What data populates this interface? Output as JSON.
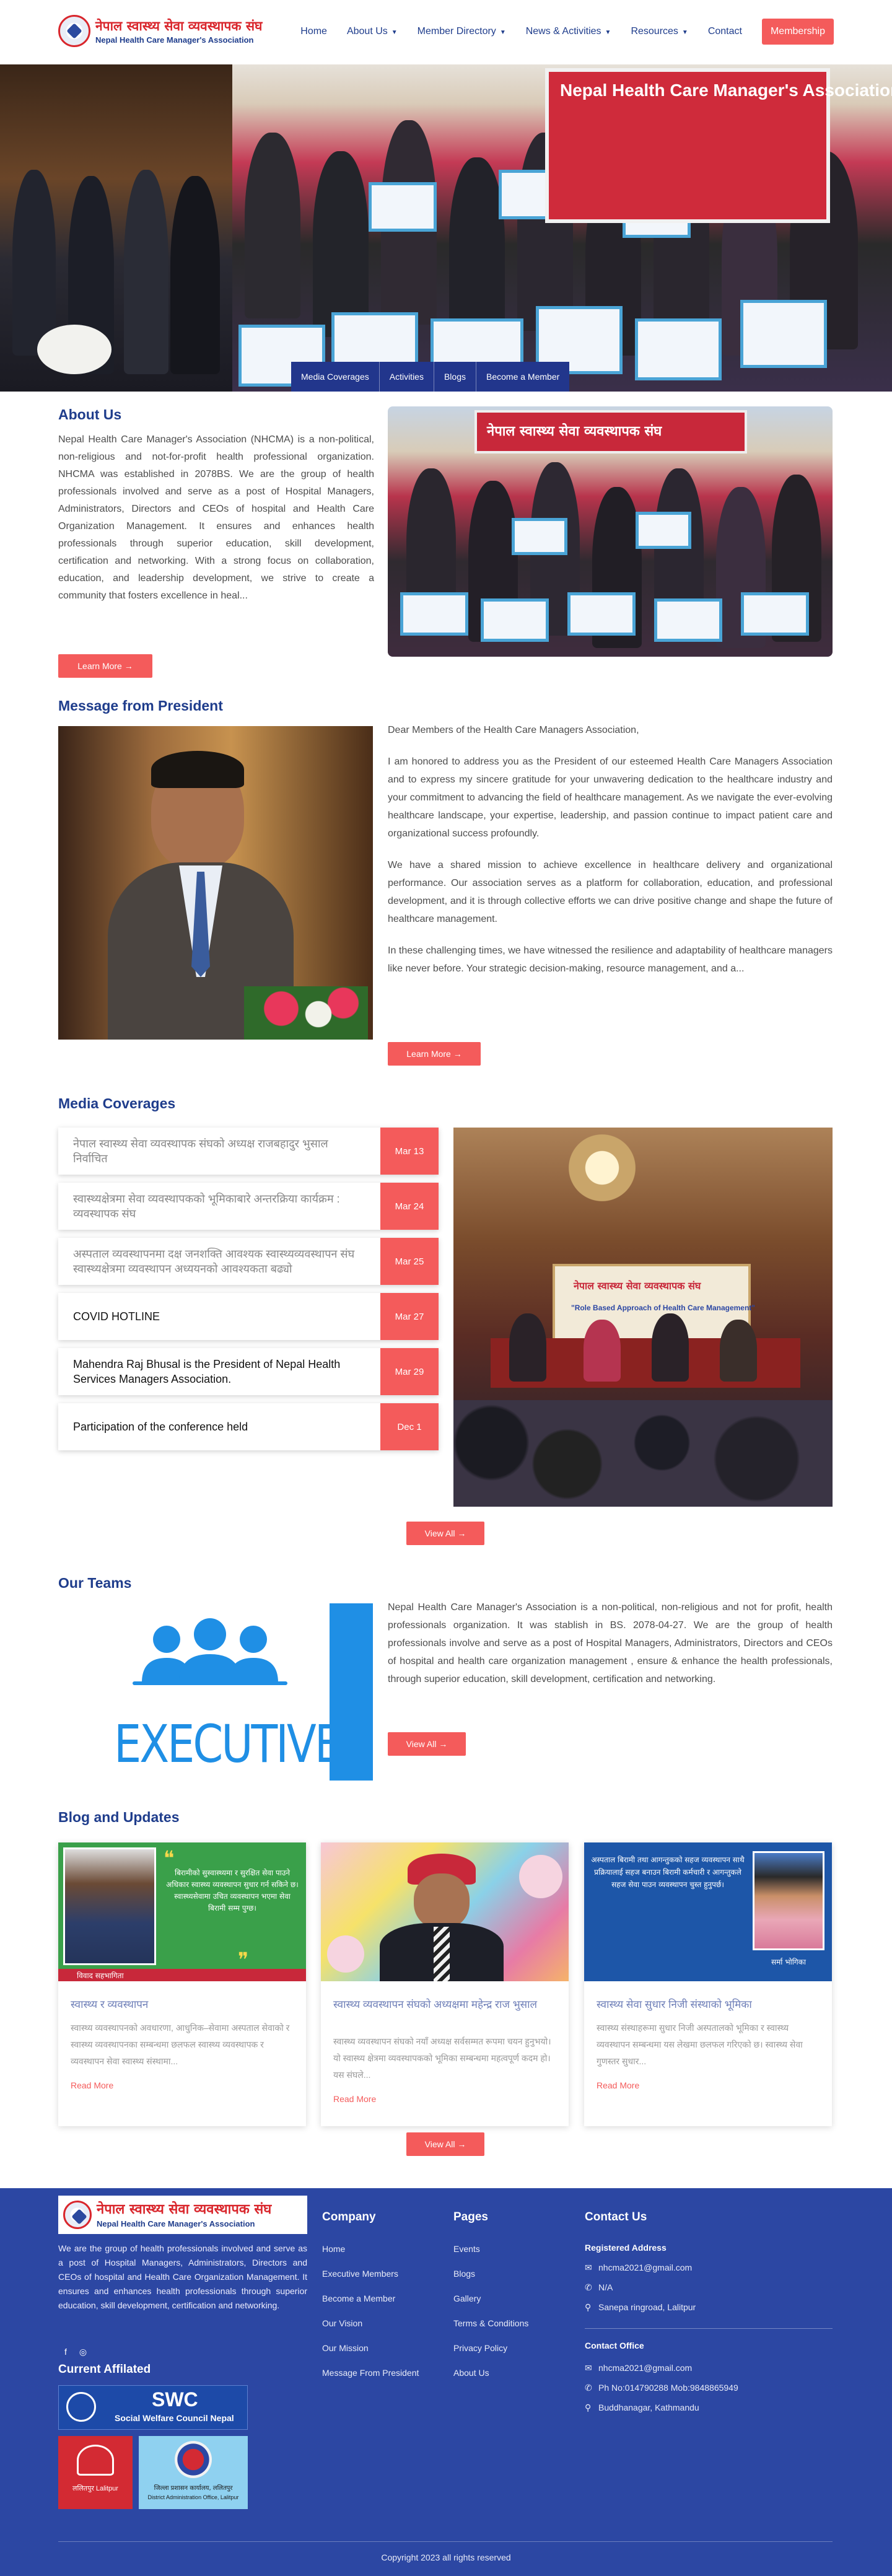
{
  "colors": {
    "primary_blue": "#1f3d8c",
    "accent_red": "#f45b5b",
    "footer_blue": "#2c47a3",
    "team_blue": "#1f8fe5"
  },
  "header": {
    "logo_np": "नेपाल स्वास्थ्य सेवा व्यवस्थापक संघ",
    "logo_en": "Nepal Health Care Manager's Association",
    "nav": [
      {
        "label": "Home",
        "dropdown": false
      },
      {
        "label": "About Us",
        "dropdown": true
      },
      {
        "label": "Member Directory",
        "dropdown": true
      },
      {
        "label": "News & Activities",
        "dropdown": true
      },
      {
        "label": "Resources",
        "dropdown": true
      },
      {
        "label": "Contact",
        "dropdown": false
      }
    ],
    "membership_label": "Membership"
  },
  "hero": {
    "banner_text": "Nepal Health Care Manager's Association",
    "tabs": [
      "Media Coverages",
      "Activities",
      "Blogs",
      "Become a Member"
    ]
  },
  "about": {
    "title": "About Us",
    "text": "Nepal Health Care Manager's Association (NHCMA) is a non-political, non-religious and not-for-profit health professional organization. NHCMA was established in 2078BS. We are the group of health professionals involved and serve as a post of Hospital Managers, Administrators, Directors and CEOs of hospital and Health Care Organization Management. It ensures and enhances health professionals through superior education, skill development, certification and networking. With a strong focus on collaboration, education, and leadership development, we strive to create a community that fosters excellence in heal...",
    "button": "Learn More →",
    "photo_banner": "नेपाल स्वास्थ्य सेवा व्यवस्थापक संघ"
  },
  "president": {
    "title": "Message from President",
    "paragraphs": [
      "Dear Members of the Health Care Managers Association,",
      "I am honored to address you as the President of our esteemed Health Care Managers Association and to express my sincere gratitude for your unwavering dedication to the healthcare industry and your commitment to advancing the field of healthcare management. As we navigate the ever-evolving healthcare landscape, your expertise, leadership, and passion continue to impact patient care and organizational success profoundly.",
      "We have a shared mission to achieve excellence in healthcare delivery and organizational performance. Our association serves as a platform for collaboration, education, and professional development, and it is through collective efforts we can drive positive change and shape the future of healthcare management.",
      "In these challenging times, we have witnessed the resilience and adaptability of healthcare managers like never before. Your strategic decision-making, resource management, and a..."
    ],
    "button": "Learn More →"
  },
  "media": {
    "title": "Media Coverages",
    "items": [
      {
        "title": "नेपाल स्वास्थ्य सेवा व्यवस्थापक संघको अध्यक्ष राजबहादुर भुसाल निर्वाचित",
        "date": "Mar 13",
        "faded": true
      },
      {
        "title": "स्वास्थ्यक्षेत्रमा सेवा व्यवस्थापकको भूमिकाबारे अन्तरक्रिया कार्यक्रम : व्यवस्थापक संघ",
        "date": "Mar 24",
        "faded": true
      },
      {
        "title": "अस्पताल व्यवस्थापनमा दक्ष जनशक्ति आवश्यक स्वास्थ्यव्यवस्थापन संघ स्वास्थ्यक्षेत्रमा व्यवस्थापन अध्ययनको आवश्यकता बढ्यो",
        "date": "Mar 25",
        "faded": true
      },
      {
        "title": "COVID HOTLINE",
        "date": "Mar 27",
        "faded": false
      },
      {
        "title": "Mahendra Raj Bhusal is the President of Nepal Health Services Managers Association.",
        "date": "Mar 29",
        "faded": false
      },
      {
        "title": "Participation of the conference held",
        "date": "Dec 1",
        "faded": false
      }
    ],
    "photo_banner": "नेपाल स्वास्थ्य सेवा व्यवस्थापक संघ",
    "photo_subtitle": "\"Role Based Approach of Health Care Management\"",
    "button": "View All →"
  },
  "teams": {
    "title": "Our Teams",
    "image_label": "EXECUTIVE COMMITTEE",
    "text": "Nepal Health Care Manager's Association is a non-political, non-religious and not for profit, health professionals organization. It was stablish in BS. 2078-04-27. We are the group of health professionals involve and serve as a post of Hospital Managers, Administrators, Directors and CEOs of hospital and health care organization management , ensure & enhance the health professionals, through superior education, skill development, certification and networking.",
    "button": "View All →"
  },
  "blog": {
    "title": "Blog and Updates",
    "posts": [
      {
        "title": "स्वास्थ्य र व्यवस्थापन",
        "excerpt": "स्वास्थ्य व्यवस्थापनको अवधारणा, आधुनिक–सेवामा अस्पताल सेवाको र स्वास्थ्य व्यवस्थापनका सम्बन्धमा छलफल स्वास्थ्य व्यवस्थापक र व्यवस्थापन सेवा स्वास्थ्य संस्थामा...",
        "image_quote": "बिरामीको सुस्वास्थ्यमा र सुरक्षित सेवा पाउने अधिकार स्वास्थ्य व्यवस्थापन सुधार गर्न सकिने छ। स्वास्थ्यसेवामा उचित व्यवस्थापन भएमा सेवा बिरामी सम्म पुग्छ।",
        "image_caption": "विवाद सहभागिता",
        "readmore": "Read More"
      },
      {
        "title": "स्वास्थ्य व्यवस्थापन संघको अध्यक्षमा महेन्द्र राज भुसाल",
        "excerpt": "स्वास्थ्य व्यवस्थापन संघको नयाँ अध्यक्ष सर्वसम्मत रूपमा चयन हुनुभयो। यो स्वास्थ्य क्षेत्रमा व्यवस्थापकको भूमिका सम्बन्धमा महत्वपूर्ण कदम हो। यस संघले...",
        "readmore": "Read More"
      },
      {
        "title": "स्वास्थ्य सेवा सुधार निजी संस्थाको भूमिका",
        "excerpt": "स्वास्थ्य संस्थाहरूमा सुधार निजी अस्पतालको भूमिका र स्वास्थ्य व्यवस्थापन सम्बन्धमा यस लेखमा छलफल गरिएको छ। स्वास्थ्य सेवा गुणस्तर सुधार...",
        "image_quote": "अस्पताल बिरामी तथा आगन्तुकको सहज व्यवस्थापन साथै प्रक्रियालाई सहज बनाउन बिरामी कर्मचारी र आगन्तुकले सहज सेवा पाउन व्यवस्थापन चुस्त हुनुपर्छ।",
        "image_caption": "सर्मा भोगिका",
        "readmore": "Read More"
      }
    ],
    "button": "View All →"
  },
  "footer": {
    "description": "We are the group of health professionals involved and serve as a post of Hospital Managers, Administrators, Directors and CEOs of hospital and Health Care Organization Management. It ensures and enhances health professionals through superior education, skill development, certification and networking.",
    "affiliated_title": "Current Affilated",
    "swc_title": "SWC",
    "swc_subtitle": "Social Welfare Council Nepal",
    "lalitpur_label": "ललितपुर Lalitpur",
    "dao_label": "जिल्ला प्रशासन कार्यालय, ललितपुर",
    "dao_sublabel": "District Administration Office, Lalitpur",
    "company_title": "Company",
    "company_links": [
      "Home",
      "Executive Members",
      "Become a Member",
      "Our Vision",
      "Our Mission",
      "Message From President"
    ],
    "pages_title": "Pages",
    "pages_links": [
      "Events",
      "Blogs",
      "Gallery",
      "Terms & Conditions",
      "Privacy Policy",
      "About Us"
    ],
    "contact_title": "Contact Us",
    "registered_title": "Registered Address",
    "registered": [
      {
        "icon": "email-icon",
        "text": "nhcma2021@gmail.com"
      },
      {
        "icon": "phone-icon",
        "text": "N/A"
      },
      {
        "icon": "location-icon",
        "text": "Sanepa ringroad, Lalitpur"
      }
    ],
    "office_title": "Contact Office",
    "office": [
      {
        "icon": "email-icon",
        "text": "nhcma2021@gmail.com"
      },
      {
        "icon": "phone-icon",
        "text": "Ph No:014790288 Mob:9848865949"
      },
      {
        "icon": "location-icon",
        "text": "Buddhanagar, Kathmandu"
      }
    ],
    "copyright": "Copyright 2023 all rights reserved"
  }
}
